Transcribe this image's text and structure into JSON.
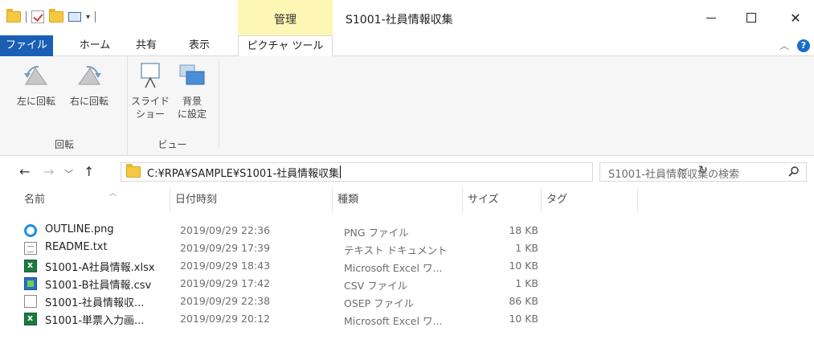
{
  "window": {
    "title": "S1001-社員情報収集",
    "context_tab_header": "管理"
  },
  "ribbon": {
    "tabs": [
      "ファイル",
      "ホーム",
      "共有",
      "表示",
      "ピクチャ ツール"
    ],
    "rotate_group": {
      "label": "回転",
      "rotate_left": "左に回転",
      "rotate_right": "右に回転"
    },
    "view_group": {
      "label": "ビュー",
      "slideshow": [
        "スライド",
        "ショー"
      ],
      "set_background": [
        "背景",
        "に設定"
      ]
    }
  },
  "address": {
    "path": "C:¥RPA¥SAMPLE¥S1001-社員情報収集"
  },
  "search": {
    "placeholder": "S1001-社員情報収集の検索"
  },
  "columns": {
    "name": "名前",
    "date": "日付時刻",
    "type": "種類",
    "size": "サイズ",
    "tag": "タグ"
  },
  "files": [
    {
      "name": "OUTLINE.png",
      "date": "2019/09/29 22:36",
      "type": "PNG ファイル",
      "size": "18 KB",
      "icon": "ie-icon"
    },
    {
      "name": "README.txt",
      "date": "2019/09/29 17:39",
      "type": "テキスト ドキュメント",
      "size": "1 KB",
      "icon": "text-document-icon"
    },
    {
      "name": "S1001-A社員情報.xlsx",
      "date": "2019/09/29 18:43",
      "type": "Microsoft Excel ワ...",
      "size": "10 KB",
      "icon": "excel-icon"
    },
    {
      "name": "S1001-B社員情報.csv",
      "date": "2019/09/29 17:42",
      "type": "CSV ファイル",
      "size": "1 KB",
      "icon": "csv-icon"
    },
    {
      "name": "S1001-社員情報収...",
      "date": "2019/09/29 22:38",
      "type": "OSEP ファイル",
      "size": "86 KB",
      "icon": "blank-file-icon"
    },
    {
      "name": "S1001-単票入力画...",
      "date": "2019/09/29 20:12",
      "type": "Microsoft Excel ワ...",
      "size": "10 KB",
      "icon": "excel-icon"
    }
  ],
  "colors": {
    "file_tab": "#1a5fb4",
    "context_tab": "#fdf6b5",
    "folder": "#f5c842"
  }
}
